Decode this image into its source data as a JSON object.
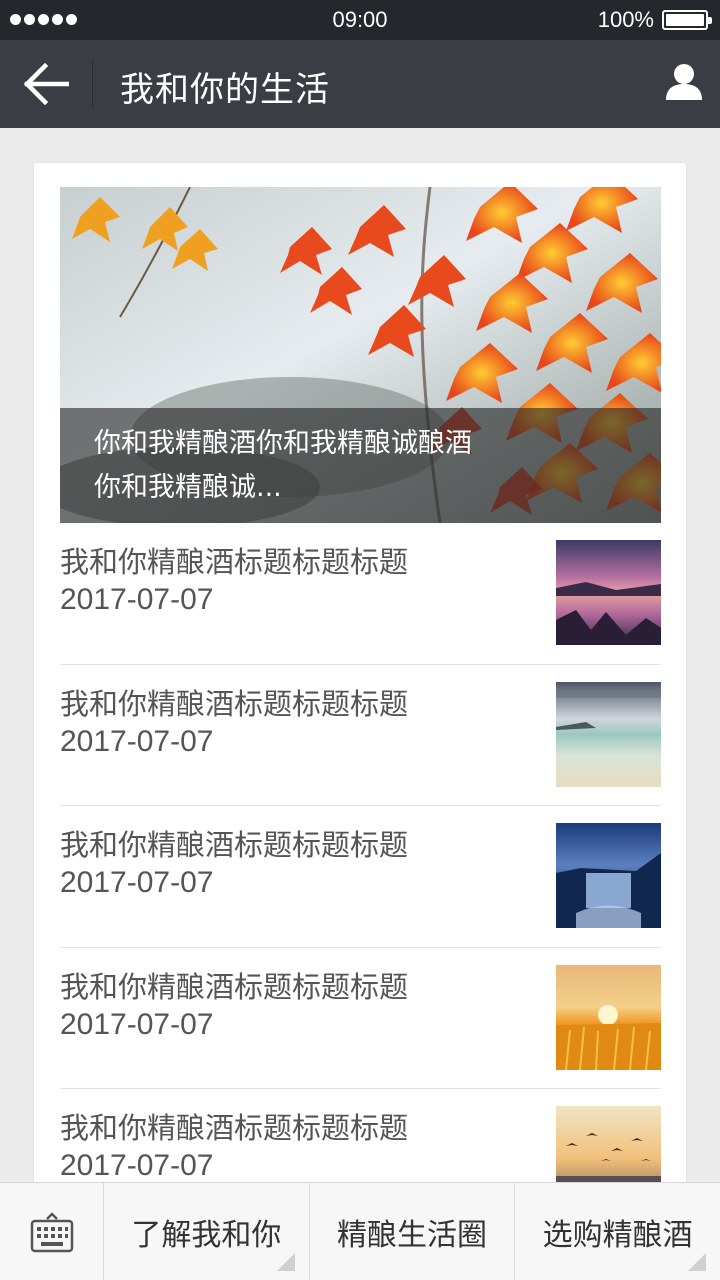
{
  "status_bar": {
    "time": "09:00",
    "battery": "100%",
    "signal_icon": "signal-dots-icon",
    "battery_icon": "battery-icon"
  },
  "nav": {
    "title": "我和你的生活",
    "back_icon": "arrow-left-icon",
    "user_icon": "user-icon"
  },
  "hero": {
    "caption_line1": "你和我精酿酒你和我精酿诚酿酒",
    "caption_line2": "你和我精酿诚..."
  },
  "articles": [
    {
      "title": "我和你精酿酒标题标题标题",
      "date": "2017-07-07",
      "thumb": "purple-lake-sunset"
    },
    {
      "title": "我和你精酿酒标题标题标题",
      "date": "2017-07-07",
      "thumb": "beach-long-exposure"
    },
    {
      "title": "我和你精酿酒标题标题标题",
      "date": "2017-07-07",
      "thumb": "blue-waterfall"
    },
    {
      "title": "我和你精酿酒标题标题标题",
      "date": "2017-07-07",
      "thumb": "golden-wheat-sunset"
    },
    {
      "title": "我和你精酿酒标题标题标题",
      "date": "2017-07-07",
      "thumb": "birds-sea-sunset"
    }
  ],
  "bottom_menu": {
    "keyboard_icon": "keyboard-icon",
    "items": [
      "了解我和你",
      "精酿生活圈",
      "选购精酿酒"
    ]
  },
  "colors": {
    "status_bar": "#24272c",
    "nav_bar": "#3a3d43",
    "page_bg": "#ebebeb",
    "text": "#555555"
  }
}
